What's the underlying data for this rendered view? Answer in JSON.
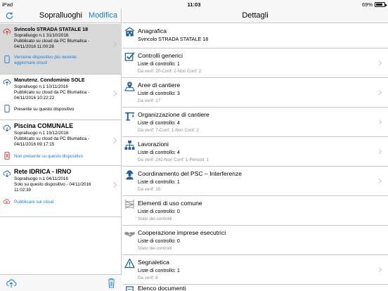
{
  "status_bar": {
    "carrier": "iPad",
    "time": "11:03",
    "battery": "69%",
    "battery_level_pct": 69
  },
  "master": {
    "title": "Sopralluoghi",
    "edit_label": "Modifica",
    "items": [
      {
        "name": "Svincolo STRADA STATALE 18",
        "lines": [
          "Sopralluogo n.1 31/10/2016",
          "Pubblicato su cloud da PC Blumatica -",
          "04/11/2016 11:00:28"
        ],
        "note": "Versione dispositivo più recente: aggiornare cloud",
        "note_lines": [
          "Versione dispositivo più recente:",
          "aggiornare cloud"
        ],
        "note_color": "#1b7bd6",
        "selected": true
      },
      {
        "name": "Manutenz. Condominio SOLE",
        "lines": [
          "Sopralluogo n.1 10/11/2016",
          "Pubblicato su cloud da PC Blumatica -",
          "04/11/2016 10:22:22"
        ],
        "note_lines": [
          "Presente su questo dispositivo"
        ],
        "note_color": "#000000",
        "selected": false
      },
      {
        "name": "Piscina COMUNALE",
        "lines": [
          "Sopralluogo n.1 19/12/2016",
          "Pubblicato su cloud da PC Blumatica -",
          "04/11/2016 09:17:15"
        ],
        "note_lines": [
          "Non presente su questo dispositivo"
        ],
        "note_color": "#1b7bd6",
        "selected": false
      },
      {
        "name": "Rete IDRICA - IRNO",
        "lines": [
          "Sopralluogo n.1 04/11/2016",
          "Solo su questo dispositivo - 04/11/2016",
          "11:02:39"
        ],
        "note_lines": [
          "Pubblicare sul cloud"
        ],
        "note_color": "#1b7bd6",
        "selected": false
      }
    ]
  },
  "detail": {
    "title": "Dettagli",
    "rows": [
      {
        "title": "Anagrafica",
        "subtitle": "Svincolo STRADA STATALE 18",
        "status": "",
        "icon": "building-icon"
      },
      {
        "title": "Controlli generici",
        "subtitle": "Liste di controllo: 1",
        "status": "Da verif: 20-Conf: 2-Non Conf: 2",
        "icon": "checkbox-icon"
      },
      {
        "title": "Aree di cantiere",
        "subtitle": "Liste di controllo: 3",
        "status": "Da verif: 17",
        "icon": "map-pin-icon"
      },
      {
        "title": "Organizzazione di cantiere",
        "subtitle": "Liste di controllo: 4",
        "status": "Da verif: 7-Conf: 1-Non Conf: 2",
        "icon": "crane-icon"
      },
      {
        "title": "Lavorazioni",
        "subtitle": "Liste di controllo: 4",
        "status": "Da verif: 242-Non Conf: 1-Pericoli: 1",
        "icon": "hierarchy-icon"
      },
      {
        "title": "Coordinamento del PSC – Interferenze",
        "subtitle": "Liste di controllo: 1",
        "status": "Da verif: 15",
        "icon": "worker-icon"
      },
      {
        "title": "Elementi di uso comune",
        "subtitle": "Liste di controllo: 0",
        "status": "Stato dei controlli",
        "icon": "scaffold-icon"
      },
      {
        "title": "Cooperazione imprese esecutrici",
        "subtitle": "Liste di controllo: 0",
        "status": "Stato dei controlli",
        "icon": "handshake-icon"
      },
      {
        "title": "Segnaletica",
        "subtitle": "Liste di controllo: 1",
        "status": "Da verif: 8",
        "icon": "warning-sign-icon"
      },
      {
        "title": "Elenco documenti",
        "subtitle": "",
        "status": "",
        "icon": "documents-icon"
      }
    ]
  },
  "colors": {
    "accent": "#1b7bd6",
    "icon_blue": "#1f5f9e",
    "cloud_red": "#d0312d"
  }
}
